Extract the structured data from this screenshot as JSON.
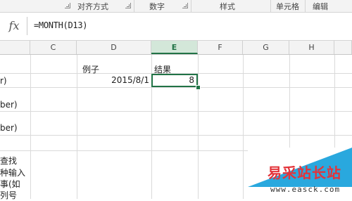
{
  "ribbon": {
    "groups": [
      "对齐方式",
      "数字",
      "样式",
      "单元格",
      "编辑"
    ]
  },
  "formula_bar": {
    "fx_label": "fx",
    "formula": "=MONTH(D13)"
  },
  "columns": [
    "C",
    "D",
    "E",
    "F",
    "G",
    "H"
  ],
  "selected_column": "E",
  "cells": {
    "d_header": "例子",
    "e_header": "结果",
    "d_value": "2015/8/1",
    "e_value": "8"
  },
  "left_fragments": [
    "r)",
    "ber)",
    "ber)",
    "查找",
    "种输入",
    "事(如",
    "列号"
  ],
  "watermark": {
    "title": "易采站长站",
    "url": "www.easck.com",
    "accent": "#29a8de",
    "title_color": "#e3343a"
  }
}
